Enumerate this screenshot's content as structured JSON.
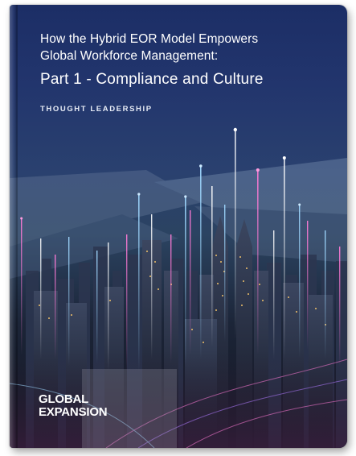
{
  "cover": {
    "title_line1": "How the Hybrid EOR Model Empowers",
    "title_line2": "Global Workforce Management:",
    "part_title": "Part 1 - Compliance and Culture",
    "category": "THOUGHT LEADERSHIP",
    "brand_line1": "GLOBAL",
    "brand_line2": "EXPANSION"
  },
  "colors": {
    "sky_top": "#1c2e66",
    "sky_bottom": "#10131f",
    "light_pink": "#ff6fd0",
    "light_cyan": "#9fd8ff",
    "window_gold": "#f3c36a"
  }
}
